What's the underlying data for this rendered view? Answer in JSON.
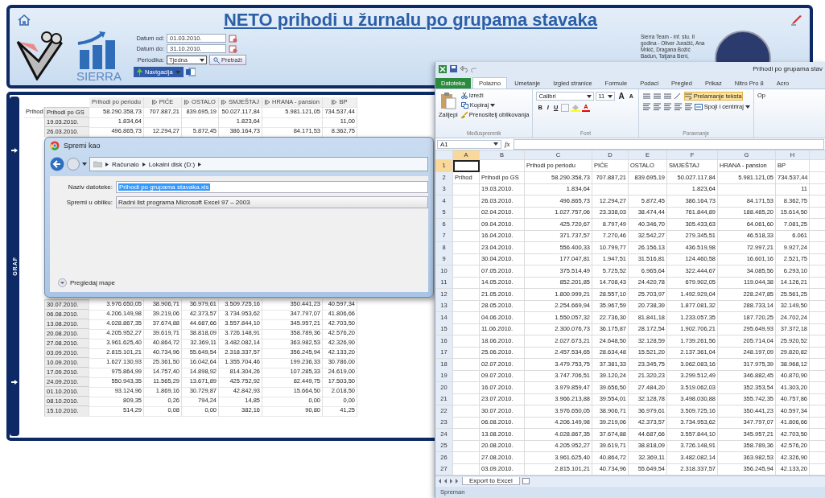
{
  "app": {
    "title": "NETO prihodi u žurnalu po grupama stavaka",
    "logo_text": "SIERRA",
    "filters": [
      {
        "label": "Datum od:",
        "value": "01.03.2010.",
        "kind": "date"
      },
      {
        "label": "Datum do:",
        "value": "31.10.2010.",
        "kind": "date"
      },
      {
        "label": "Periodika:",
        "value": "Tjedna",
        "kind": "select"
      }
    ],
    "search_button": "Pretraži",
    "navigation_button": "Navigacija",
    "team_text": "Sierra Team - inf. stu. II godina - Oliver Juračić, Ana Mrkić, Dragana Božić Badun, Tatjana Beni,"
  },
  "side_tab": "GRAF",
  "pivot": {
    "columns": [
      {
        "label": "Prihodi po periodu",
        "expandable": false
      },
      {
        "label": "PIĆE",
        "expandable": true
      },
      {
        "label": "OSTALO",
        "expandable": true
      },
      {
        "label": "SMJEŠTAJ",
        "expandable": true
      },
      {
        "label": "HRANA - pansion",
        "expandable": true
      },
      {
        "label": "BP",
        "expandable": true
      }
    ],
    "top_rows": [
      {
        "group": "Prihod",
        "label": "Prihodi po GS",
        "values": [
          "58.290.358,73",
          "707.887,21",
          "839.695,19",
          "50.027.117,84",
          "5.981.121,05",
          "734.537,44"
        ]
      },
      {
        "label": "19.03.2010.",
        "values": [
          {
            "kind": "value",
            "text": "1.834,64"
          },
          {
            "kind": "empty"
          },
          {
            "kind": "empty"
          },
          {
            "kind": "value",
            "text": "1.823,64"
          },
          {
            "kind": "empty"
          },
          {
            "kind": "value",
            "text": "11,00"
          }
        ]
      },
      {
        "label": "26.03.2010.",
        "values": [
          "496.865,73",
          "12.294,27",
          "5.872,45",
          "386.164,73",
          "84.171,53",
          "8.362,75"
        ]
      }
    ],
    "bottom_rows": [
      {
        "label": "30.07.2010.",
        "values": [
          "3.976.650,05",
          "38.906,71",
          "36.979,61",
          "3.509.725,16",
          "350.441,23",
          "40.597,34"
        ]
      },
      {
        "label": "06.08.2010.",
        "values": [
          "4.206.149,98",
          "39.219,06",
          "42.373,57",
          "3.734.953,62",
          "347.797,07",
          "41.806,66"
        ]
      },
      {
        "label": "13.08.2010.",
        "values": [
          "4.028.867,35",
          "37.674,88",
          "44.687,66",
          "3.557.844,10",
          "345.957,21",
          "42.703,50"
        ]
      },
      {
        "label": "20.08.2010.",
        "values": [
          "4.205.952,27",
          "39.619,71",
          "38.818,09",
          "3.726.148,91",
          "358.789,36",
          "42.576,20"
        ]
      },
      {
        "label": "27.08.2010.",
        "values": [
          "3.961.625,40",
          "40.864,72",
          "32.369,11",
          "3.482.082,14",
          "363.982,53",
          "42.326,90"
        ]
      },
      {
        "label": "03.09.2010.",
        "values": [
          "2.815.101,21",
          "40.734,96",
          "55.649,54",
          "2.318.337,57",
          "356.245,94",
          "42.133,20"
        ]
      },
      {
        "label": "10.09.2010.",
        "values": [
          "1.627.130,93",
          "25.361,50",
          "16.042,64",
          "1.355.704,46",
          "199.236,33",
          "30.786,00"
        ]
      },
      {
        "label": "17.09.2010.",
        "values": [
          "975.864,99",
          "14.757,40",
          "14.898,92",
          "814.304,26",
          "107.285,33",
          "24.619,00"
        ]
      },
      {
        "label": "24.09.2010.",
        "values": [
          "550.943,35",
          "11.565,29",
          "13.671,89",
          "425.752,92",
          "82.449,75",
          "17.503,50"
        ]
      },
      {
        "label": "01.10.2010.",
        "values": [
          "93.124,96",
          "1.869,16",
          "30.729,87",
          "42.842,93",
          "15.664,50",
          "2.018,50"
        ]
      },
      {
        "label": "08.10.2010.",
        "values": [
          "809,35",
          "0,26",
          "794,24",
          "14,85",
          "0,00",
          "0,00"
        ]
      },
      {
        "label": "15.10.2010.",
        "values": [
          "514,29",
          "0,08",
          "0,00",
          "382,16",
          "90,80",
          "41,25"
        ]
      }
    ]
  },
  "dialog": {
    "title": "Spremi kao",
    "breadcrumb": [
      "Računalo",
      "Lokalni disk (D:)"
    ],
    "fields": [
      {
        "label": "Naziv datoteke:",
        "value": "Prihodi po grupama stavaka.xls",
        "kind": "text"
      },
      {
        "label": "Spremi u obliku:",
        "value": "Radni list programa Microsoft Excel 97 – 2003",
        "kind": "select"
      }
    ],
    "browse_toggle": "Pregledaj mape"
  },
  "excel": {
    "title": "Prihodi po grupama stav",
    "tabs": [
      {
        "label": "Datoteka",
        "kind": "file",
        "selected": false
      },
      {
        "label": "Polazno",
        "kind": "tab",
        "selected": true
      },
      {
        "label": "Umetanje",
        "kind": "tab",
        "selected": false
      },
      {
        "label": "Izgled stranice",
        "kind": "tab",
        "selected": false
      },
      {
        "label": "Formule",
        "kind": "tab",
        "selected": false
      },
      {
        "label": "Podaci",
        "kind": "tab",
        "selected": false
      },
      {
        "label": "Pregled",
        "kind": "tab",
        "selected": false
      },
      {
        "label": "Prikaz",
        "kind": "tab",
        "selected": false
      },
      {
        "label": "Nitro Pro 8",
        "kind": "tab",
        "selected": false
      },
      {
        "label": "Acro",
        "kind": "tab",
        "selected": false
      }
    ],
    "clipboard": {
      "paste": "Zalijepi",
      "cut": "Izreži",
      "copy": "Kopiraj",
      "format_painter": "Prenositelj oblikovanja",
      "group": "Međuspremnik"
    },
    "font": {
      "name": "Calibri",
      "size": "11",
      "grow": "A",
      "shrink": "A",
      "styles": [
        "B",
        "I",
        "U"
      ],
      "font_color_button": "A",
      "group": "Font"
    },
    "alignment": {
      "wrap": {
        "label": "Prelamanje teksta",
        "on": true
      },
      "merge": "Spoji i centriraj",
      "group": "Poravnanje",
      "next_group": "Op"
    },
    "name_box": "A1",
    "function_label": "fx",
    "columns": [
      {
        "label": "A",
        "selected": true
      },
      {
        "label": "B",
        "selected": false
      },
      {
        "label": "C",
        "selected": false
      },
      {
        "label": "D",
        "selected": false
      },
      {
        "label": "E",
        "selected": false
      },
      {
        "label": "F",
        "selected": false
      },
      {
        "label": "G",
        "selected": false
      },
      {
        "label": "H",
        "selected": false
      }
    ],
    "rows": [
      {
        "n": "1",
        "selected": true,
        "cells": [
          {
            "kind": "empty"
          },
          {
            "kind": "empty"
          },
          {
            "kind": "value",
            "text": "Prihodi po periodu"
          },
          {
            "kind": "value",
            "text": "PIĆE"
          },
          {
            "kind": "value",
            "text": "OSTALO"
          },
          {
            "kind": "value",
            "text": "SMJEŠTAJ"
          },
          {
            "kind": "value",
            "text": "HRANA - pansion"
          },
          {
            "kind": "value",
            "text": "BP"
          }
        ]
      },
      {
        "n": "2",
        "selected": false,
        "cells": [
          "Prihod",
          "Prihodi po GS",
          "58.290.358,73",
          "707.887,21",
          "839.695,19",
          "50.027.117,84",
          "5.981.121,05",
          "734.537,44"
        ]
      },
      {
        "n": "3",
        "selected": false,
        "cells": [
          {
            "kind": "empty"
          },
          {
            "kind": "value",
            "text": "19.03.2010."
          },
          {
            "kind": "value",
            "text": "1.834,64"
          },
          {
            "kind": "empty"
          },
          {
            "kind": "empty"
          },
          {
            "kind": "value",
            "text": "1.823,64"
          },
          {
            "kind": "empty"
          },
          {
            "kind": "value",
            "text": "11"
          }
        ]
      },
      {
        "n": "4",
        "selected": false,
        "cells": [
          {
            "kind": "empty"
          },
          "26.03.2010.",
          "496.865,73",
          "12.294,27",
          "5.872,45",
          "386.164,73",
          "84.171,53",
          "8.362,75"
        ]
      },
      {
        "n": "5",
        "selected": false,
        "cells": [
          {
            "kind": "empty"
          },
          "02.04.2010.",
          "1.027.757,06",
          "23.338,03",
          "38.474,44",
          "761.844,89",
          "188.485,20",
          "15.614,50"
        ]
      },
      {
        "n": "6",
        "selected": false,
        "cells": [
          {
            "kind": "empty"
          },
          "09.04.2010.",
          "425.720,67",
          "8.797,49",
          "40.346,70",
          "305.433,63",
          "64.061,60",
          "7.081,25"
        ]
      },
      {
        "n": "7",
        "selected": false,
        "cells": [
          {
            "kind": "empty"
          },
          "16.04.2010.",
          "371.737,57",
          "7.270,46",
          "32.542,27",
          "279.345,51",
          "46.518,33",
          "6.061"
        ]
      },
      {
        "n": "8",
        "selected": false,
        "cells": [
          {
            "kind": "empty"
          },
          "23.04.2010.",
          "556.400,33",
          "10.799,77",
          "26.156,13",
          "436.519,98",
          "72.997,21",
          "9.927,24"
        ]
      },
      {
        "n": "9",
        "selected": false,
        "cells": [
          {
            "kind": "empty"
          },
          "30.04.2010.",
          "177.047,81",
          "1.947,51",
          "31.516,81",
          "124.460,58",
          "16.601,16",
          "2.521,75"
        ]
      },
      {
        "n": "10",
        "selected": false,
        "cells": [
          {
            "kind": "empty"
          },
          "07.05.2010.",
          "375.514,49",
          "5.725,52",
          "6.965,64",
          "322.444,67",
          "34.085,56",
          "6.293,10"
        ]
      },
      {
        "n": "11",
        "selected": false,
        "cells": [
          {
            "kind": "empty"
          },
          "14.05.2010.",
          "852.201,85",
          "14.708,43",
          "24.420,78",
          "679.902,05",
          "119.044,38",
          "14.126,21"
        ]
      },
      {
        "n": "12",
        "selected": false,
        "cells": [
          {
            "kind": "empty"
          },
          "21.05.2010.",
          "1.800.999,21",
          "28.557,10",
          "25.703,97",
          "1.492.929,04",
          "228.247,85",
          "25.561,25"
        ]
      },
      {
        "n": "13",
        "selected": false,
        "cells": [
          {
            "kind": "empty"
          },
          "28.05.2010.",
          "2.254.669,94",
          "35.967,59",
          "20.738,39",
          "1.877.081,32",
          "288.733,14",
          "32.149,50"
        ]
      },
      {
        "n": "14",
        "selected": false,
        "cells": [
          {
            "kind": "empty"
          },
          "04.06.2010.",
          "1.550.057,32",
          "22.736,30",
          "81.841,18",
          "1.233.057,35",
          "187.720,25",
          "24.702,24"
        ]
      },
      {
        "n": "15",
        "selected": false,
        "cells": [
          {
            "kind": "empty"
          },
          "11.06.2010.",
          "2.300.076,73",
          "36.175,87",
          "28.172,54",
          "1.902.706,21",
          "295.649,93",
          "37.372,18"
        ]
      },
      {
        "n": "16",
        "selected": false,
        "cells": [
          {
            "kind": "empty"
          },
          "18.06.2010.",
          "2.027.673,21",
          "24.648,50",
          "32.128,59",
          "1.739.261,56",
          "205.714,04",
          "25.920,52"
        ]
      },
      {
        "n": "17",
        "selected": false,
        "cells": [
          {
            "kind": "empty"
          },
          "25.06.2010.",
          "2.457.534,65",
          "28.634,48",
          "15.521,20",
          "2.137.361,04",
          "248.197,09",
          "29.820,82"
        ]
      },
      {
        "n": "18",
        "selected": false,
        "cells": [
          {
            "kind": "empty"
          },
          "02.07.2010.",
          "3.479.753,75",
          "37.381,33",
          "23.345,75",
          "3.062.083,16",
          "317.975,39",
          "38.968,12"
        ]
      },
      {
        "n": "19",
        "selected": false,
        "cells": [
          {
            "kind": "empty"
          },
          "09.07.2010.",
          "3.747.706,51",
          "39.120,24",
          "21.320,23",
          "3.299.512,49",
          "346.882,45",
          "40.870,90"
        ]
      },
      {
        "n": "20",
        "selected": false,
        "cells": [
          {
            "kind": "empty"
          },
          "16.07.2010.",
          "3.979.859,47",
          "39.656,50",
          "27.484,20",
          "3.519.062,03",
          "352.353,54",
          "41.303,20"
        ]
      },
      {
        "n": "21",
        "selected": false,
        "cells": [
          {
            "kind": "empty"
          },
          "23.07.2010.",
          "3.966.213,88",
          "39.554,01",
          "32.128,78",
          "3.498.030,88",
          "355.742,35",
          "40.757,86"
        ]
      },
      {
        "n": "22",
        "selected": false,
        "cells": [
          {
            "kind": "empty"
          },
          "30.07.2010.",
          "3.976.650,05",
          "38.906,71",
          "36.979,61",
          "3.509.725,16",
          "350.441,23",
          "40.597,34"
        ]
      },
      {
        "n": "23",
        "selected": false,
        "cells": [
          {
            "kind": "empty"
          },
          "06.08.2010.",
          "4.206.149,98",
          "39.219,06",
          "42.373,57",
          "3.734.953,62",
          "347.797,07",
          "41.806,66"
        ]
      },
      {
        "n": "24",
        "selected": false,
        "cells": [
          {
            "kind": "empty"
          },
          "13.08.2010.",
          "4.028.867,35",
          "37.674,88",
          "44.687,66",
          "3.557.844,10",
          "345.957,21",
          "42.703,50"
        ]
      },
      {
        "n": "25",
        "selected": false,
        "cells": [
          {
            "kind": "empty"
          },
          "20.08.2010.",
          "4.205.952,27",
          "39.619,71",
          "38.818,09",
          "3.726.148,91",
          "358.789,36",
          "42.576,20"
        ]
      },
      {
        "n": "26",
        "selected": false,
        "cells": [
          {
            "kind": "empty"
          },
          "27.08.2010.",
          "3.961.625,40",
          "40.864,72",
          "32.369,11",
          "3.482.082,14",
          "363.982,53",
          "42.326,90"
        ]
      },
      {
        "n": "27",
        "selected": false,
        "cells": [
          {
            "kind": "empty"
          },
          "03.09.2010.",
          "2.815.101,21",
          "40.734,96",
          "55.649,54",
          "2.318.337,57",
          "356.245,94",
          "42.133,20"
        ]
      }
    ],
    "sheet_tab": "Export to Excel",
    "status": "Spreman"
  }
}
